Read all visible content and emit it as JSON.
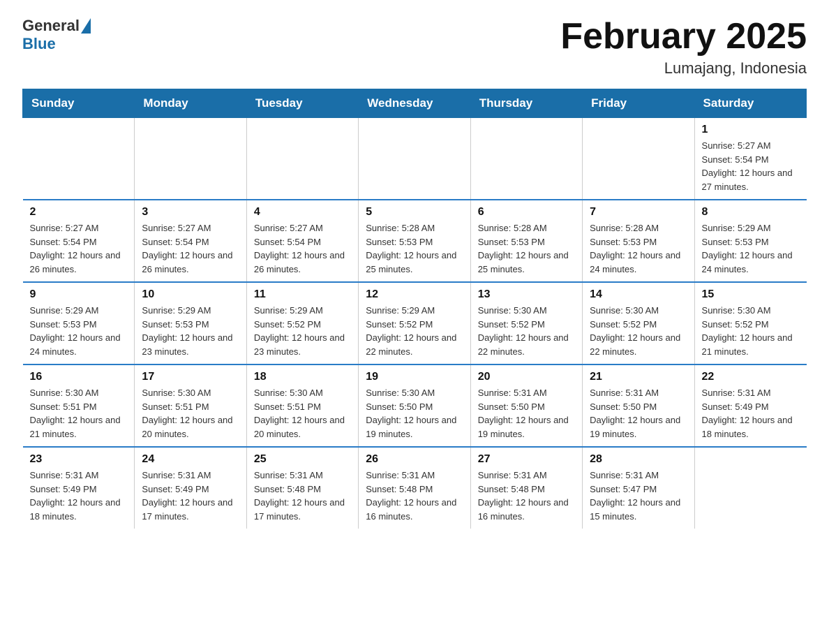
{
  "header": {
    "title": "February 2025",
    "location": "Lumajang, Indonesia",
    "logo_general": "General",
    "logo_blue": "Blue"
  },
  "weekdays": [
    "Sunday",
    "Monday",
    "Tuesday",
    "Wednesday",
    "Thursday",
    "Friday",
    "Saturday"
  ],
  "weeks": [
    [
      {
        "day": "",
        "sunrise": "",
        "sunset": "",
        "daylight": ""
      },
      {
        "day": "",
        "sunrise": "",
        "sunset": "",
        "daylight": ""
      },
      {
        "day": "",
        "sunrise": "",
        "sunset": "",
        "daylight": ""
      },
      {
        "day": "",
        "sunrise": "",
        "sunset": "",
        "daylight": ""
      },
      {
        "day": "",
        "sunrise": "",
        "sunset": "",
        "daylight": ""
      },
      {
        "day": "",
        "sunrise": "",
        "sunset": "",
        "daylight": ""
      },
      {
        "day": "1",
        "sunrise": "Sunrise: 5:27 AM",
        "sunset": "Sunset: 5:54 PM",
        "daylight": "Daylight: 12 hours and 27 minutes."
      }
    ],
    [
      {
        "day": "2",
        "sunrise": "Sunrise: 5:27 AM",
        "sunset": "Sunset: 5:54 PM",
        "daylight": "Daylight: 12 hours and 26 minutes."
      },
      {
        "day": "3",
        "sunrise": "Sunrise: 5:27 AM",
        "sunset": "Sunset: 5:54 PM",
        "daylight": "Daylight: 12 hours and 26 minutes."
      },
      {
        "day": "4",
        "sunrise": "Sunrise: 5:27 AM",
        "sunset": "Sunset: 5:54 PM",
        "daylight": "Daylight: 12 hours and 26 minutes."
      },
      {
        "day": "5",
        "sunrise": "Sunrise: 5:28 AM",
        "sunset": "Sunset: 5:53 PM",
        "daylight": "Daylight: 12 hours and 25 minutes."
      },
      {
        "day": "6",
        "sunrise": "Sunrise: 5:28 AM",
        "sunset": "Sunset: 5:53 PM",
        "daylight": "Daylight: 12 hours and 25 minutes."
      },
      {
        "day": "7",
        "sunrise": "Sunrise: 5:28 AM",
        "sunset": "Sunset: 5:53 PM",
        "daylight": "Daylight: 12 hours and 24 minutes."
      },
      {
        "day": "8",
        "sunrise": "Sunrise: 5:29 AM",
        "sunset": "Sunset: 5:53 PM",
        "daylight": "Daylight: 12 hours and 24 minutes."
      }
    ],
    [
      {
        "day": "9",
        "sunrise": "Sunrise: 5:29 AM",
        "sunset": "Sunset: 5:53 PM",
        "daylight": "Daylight: 12 hours and 24 minutes."
      },
      {
        "day": "10",
        "sunrise": "Sunrise: 5:29 AM",
        "sunset": "Sunset: 5:53 PM",
        "daylight": "Daylight: 12 hours and 23 minutes."
      },
      {
        "day": "11",
        "sunrise": "Sunrise: 5:29 AM",
        "sunset": "Sunset: 5:52 PM",
        "daylight": "Daylight: 12 hours and 23 minutes."
      },
      {
        "day": "12",
        "sunrise": "Sunrise: 5:29 AM",
        "sunset": "Sunset: 5:52 PM",
        "daylight": "Daylight: 12 hours and 22 minutes."
      },
      {
        "day": "13",
        "sunrise": "Sunrise: 5:30 AM",
        "sunset": "Sunset: 5:52 PM",
        "daylight": "Daylight: 12 hours and 22 minutes."
      },
      {
        "day": "14",
        "sunrise": "Sunrise: 5:30 AM",
        "sunset": "Sunset: 5:52 PM",
        "daylight": "Daylight: 12 hours and 22 minutes."
      },
      {
        "day": "15",
        "sunrise": "Sunrise: 5:30 AM",
        "sunset": "Sunset: 5:52 PM",
        "daylight": "Daylight: 12 hours and 21 minutes."
      }
    ],
    [
      {
        "day": "16",
        "sunrise": "Sunrise: 5:30 AM",
        "sunset": "Sunset: 5:51 PM",
        "daylight": "Daylight: 12 hours and 21 minutes."
      },
      {
        "day": "17",
        "sunrise": "Sunrise: 5:30 AM",
        "sunset": "Sunset: 5:51 PM",
        "daylight": "Daylight: 12 hours and 20 minutes."
      },
      {
        "day": "18",
        "sunrise": "Sunrise: 5:30 AM",
        "sunset": "Sunset: 5:51 PM",
        "daylight": "Daylight: 12 hours and 20 minutes."
      },
      {
        "day": "19",
        "sunrise": "Sunrise: 5:30 AM",
        "sunset": "Sunset: 5:50 PM",
        "daylight": "Daylight: 12 hours and 19 minutes."
      },
      {
        "day": "20",
        "sunrise": "Sunrise: 5:31 AM",
        "sunset": "Sunset: 5:50 PM",
        "daylight": "Daylight: 12 hours and 19 minutes."
      },
      {
        "day": "21",
        "sunrise": "Sunrise: 5:31 AM",
        "sunset": "Sunset: 5:50 PM",
        "daylight": "Daylight: 12 hours and 19 minutes."
      },
      {
        "day": "22",
        "sunrise": "Sunrise: 5:31 AM",
        "sunset": "Sunset: 5:49 PM",
        "daylight": "Daylight: 12 hours and 18 minutes."
      }
    ],
    [
      {
        "day": "23",
        "sunrise": "Sunrise: 5:31 AM",
        "sunset": "Sunset: 5:49 PM",
        "daylight": "Daylight: 12 hours and 18 minutes."
      },
      {
        "day": "24",
        "sunrise": "Sunrise: 5:31 AM",
        "sunset": "Sunset: 5:49 PM",
        "daylight": "Daylight: 12 hours and 17 minutes."
      },
      {
        "day": "25",
        "sunrise": "Sunrise: 5:31 AM",
        "sunset": "Sunset: 5:48 PM",
        "daylight": "Daylight: 12 hours and 17 minutes."
      },
      {
        "day": "26",
        "sunrise": "Sunrise: 5:31 AM",
        "sunset": "Sunset: 5:48 PM",
        "daylight": "Daylight: 12 hours and 16 minutes."
      },
      {
        "day": "27",
        "sunrise": "Sunrise: 5:31 AM",
        "sunset": "Sunset: 5:48 PM",
        "daylight": "Daylight: 12 hours and 16 minutes."
      },
      {
        "day": "28",
        "sunrise": "Sunrise: 5:31 AM",
        "sunset": "Sunset: 5:47 PM",
        "daylight": "Daylight: 12 hours and 15 minutes."
      },
      {
        "day": "",
        "sunrise": "",
        "sunset": "",
        "daylight": ""
      }
    ]
  ]
}
